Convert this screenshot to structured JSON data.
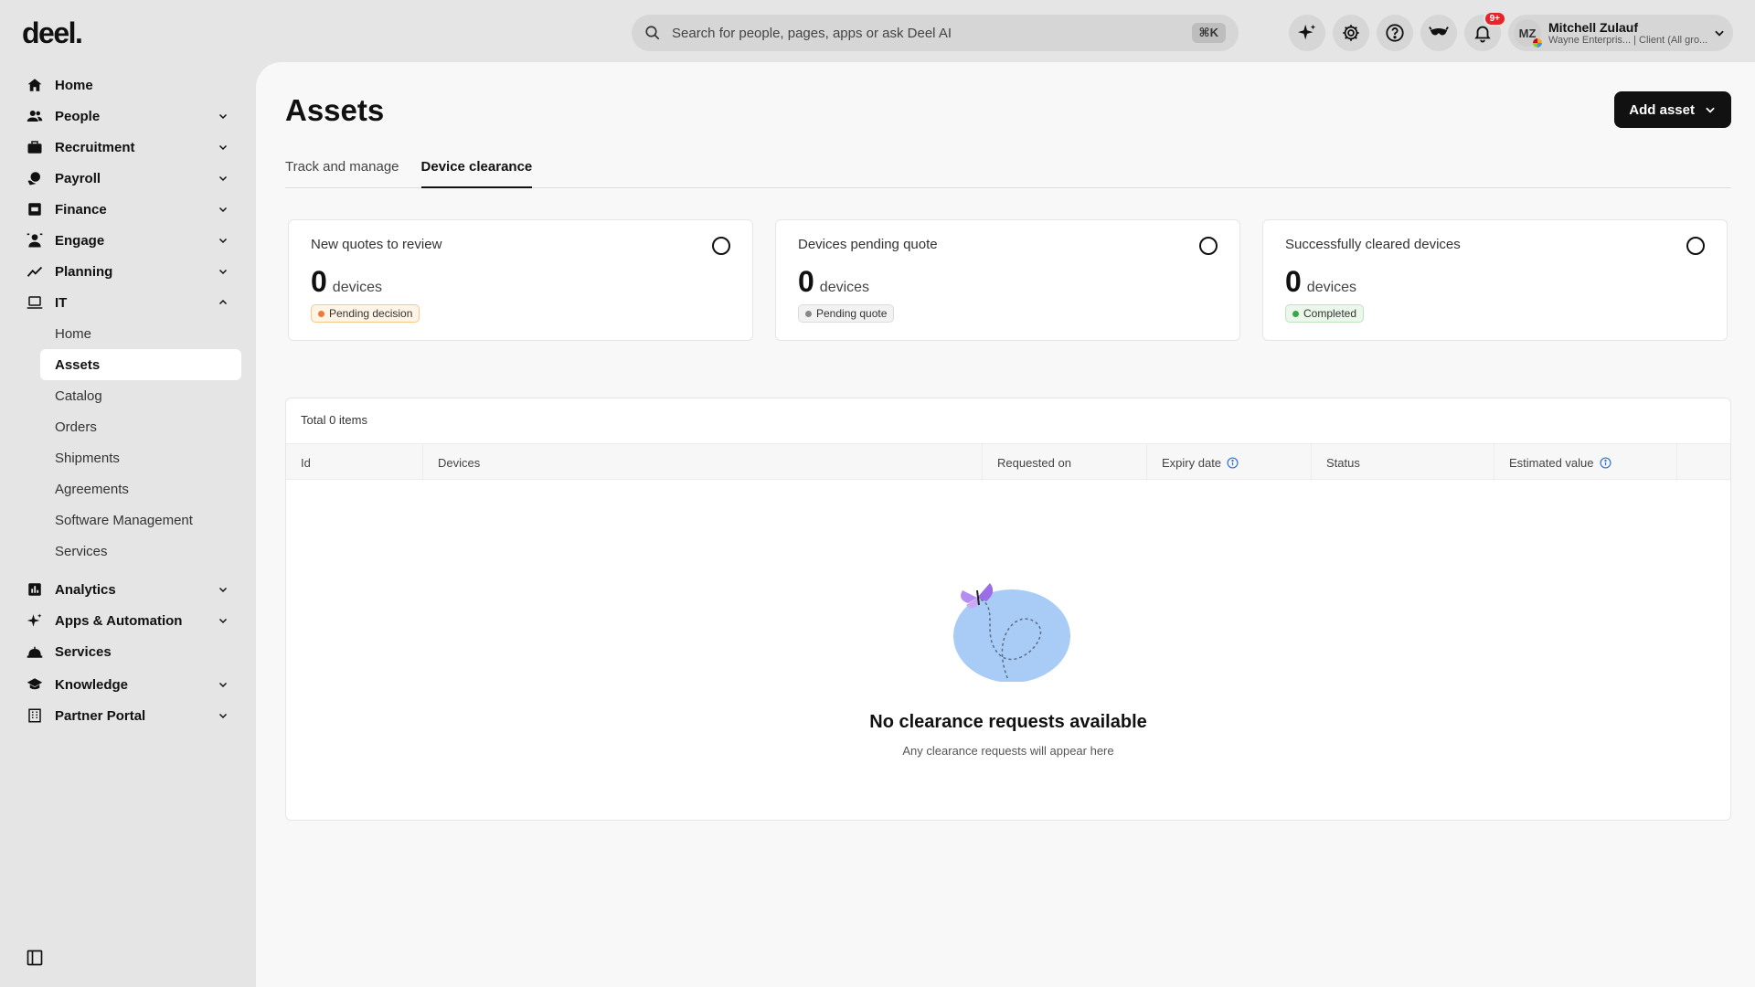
{
  "app": {
    "logo": "deel."
  },
  "search": {
    "placeholder": "Search for people, pages, apps or ask Deel AI",
    "shortcut": "⌘K"
  },
  "top_icons": [
    "sparkle-icon",
    "gear-icon",
    "help-icon",
    "eyes-icon",
    "bell-icon"
  ],
  "notifications": {
    "badge": "9+"
  },
  "user": {
    "initials": "MZ",
    "name": "Mitchell Zulauf",
    "org": "Wayne Enterpris... | Client (All gro..."
  },
  "sidebar": {
    "items": [
      {
        "label": "Home",
        "icon": "home-icon"
      },
      {
        "label": "People",
        "icon": "people-icon"
      },
      {
        "label": "Recruitment",
        "icon": "briefcase-icon"
      },
      {
        "label": "Payroll",
        "icon": "payroll-icon"
      },
      {
        "label": "Finance",
        "icon": "finance-icon"
      },
      {
        "label": "Engage",
        "icon": "engage-icon"
      },
      {
        "label": "Planning",
        "icon": "chart-line-icon"
      },
      {
        "label": "IT",
        "icon": "laptop-icon"
      }
    ],
    "it_sub": [
      "Home",
      "Assets",
      "Catalog",
      "Orders",
      "Shipments",
      "Agreements",
      "Software Management",
      "Services"
    ],
    "items_after": [
      {
        "label": "Analytics",
        "icon": "bar-chart-icon"
      },
      {
        "label": "Apps & Automation",
        "icon": "sparkle-icon"
      },
      {
        "label": "Services",
        "icon": "bell-service-icon"
      },
      {
        "label": "Knowledge",
        "icon": "graduation-cap-icon"
      },
      {
        "label": "Partner Portal",
        "icon": "building-icon"
      }
    ]
  },
  "main": {
    "title": "Assets",
    "add_button": "Add asset",
    "tabs": [
      "Track and manage",
      "Device clearance"
    ],
    "active_tab": "Device clearance",
    "cards": [
      {
        "title": "New quotes to review",
        "value": "0",
        "unit": "devices",
        "status": "Pending decision"
      },
      {
        "title": "Devices pending quote",
        "value": "0",
        "unit": "devices",
        "status": "Pending quote"
      },
      {
        "title": "Successfully cleared devices",
        "value": "0",
        "unit": "devices",
        "status": "Completed"
      }
    ],
    "table": {
      "total": "Total 0 items",
      "columns": [
        "Id",
        "Devices",
        "Requested on",
        "Expiry date",
        "Status",
        "Estimated value"
      ],
      "empty_title": "No clearance requests available",
      "empty_subtitle": "Any clearance requests will appear here"
    }
  }
}
